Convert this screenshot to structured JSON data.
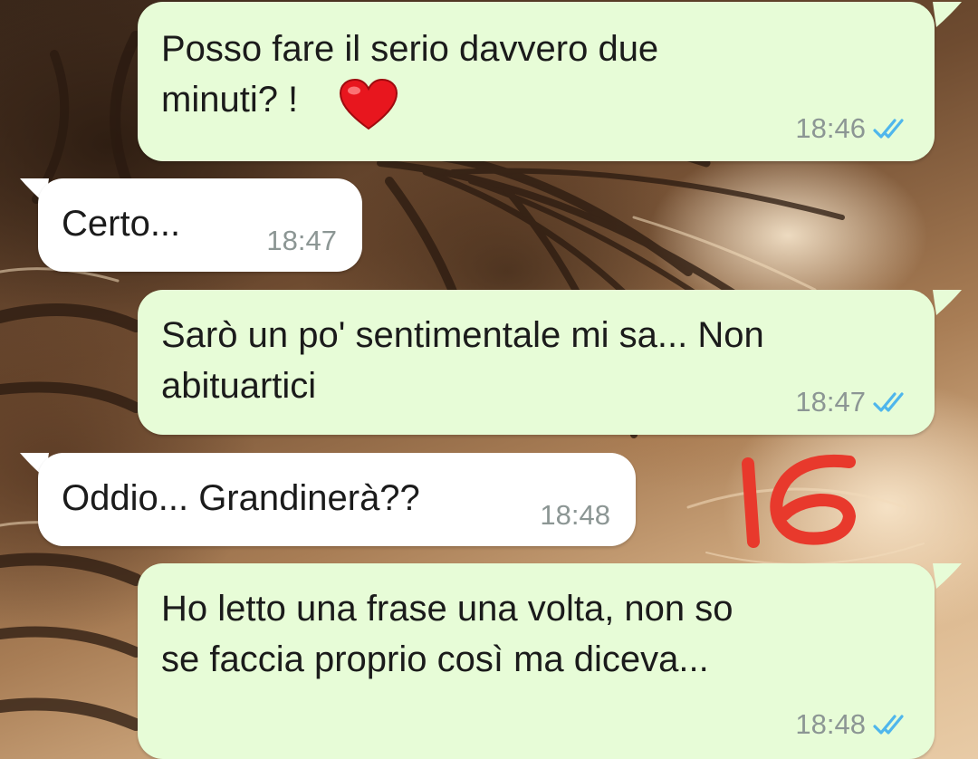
{
  "colors": {
    "outgoing_bubble": "#e7fcd7",
    "incoming_bubble": "#ffffff",
    "read_ticks": "#4fb6ec",
    "timestamp": "#8c9694",
    "annotation": "#e8392c"
  },
  "messages": [
    {
      "direction": "outgoing",
      "text": "Posso fare il serio davvero due\nminuti? ! ",
      "emoji": "heart",
      "time": "18:46",
      "status": "read"
    },
    {
      "direction": "incoming",
      "text": "Certo...",
      "time": "18:47"
    },
    {
      "direction": "outgoing",
      "text": "Sarò un po' sentimentale mi sa... Non\nabituartici",
      "time": "18:47",
      "status": "read"
    },
    {
      "direction": "incoming",
      "text": "Oddio... Grandinerà??",
      "time": "18:48"
    },
    {
      "direction": "outgoing",
      "text": "Ho letto una frase una volta, non so\nse faccia proprio così ma diceva...",
      "time": "18:48",
      "status": "read"
    }
  ],
  "annotation": {
    "text": "16"
  }
}
